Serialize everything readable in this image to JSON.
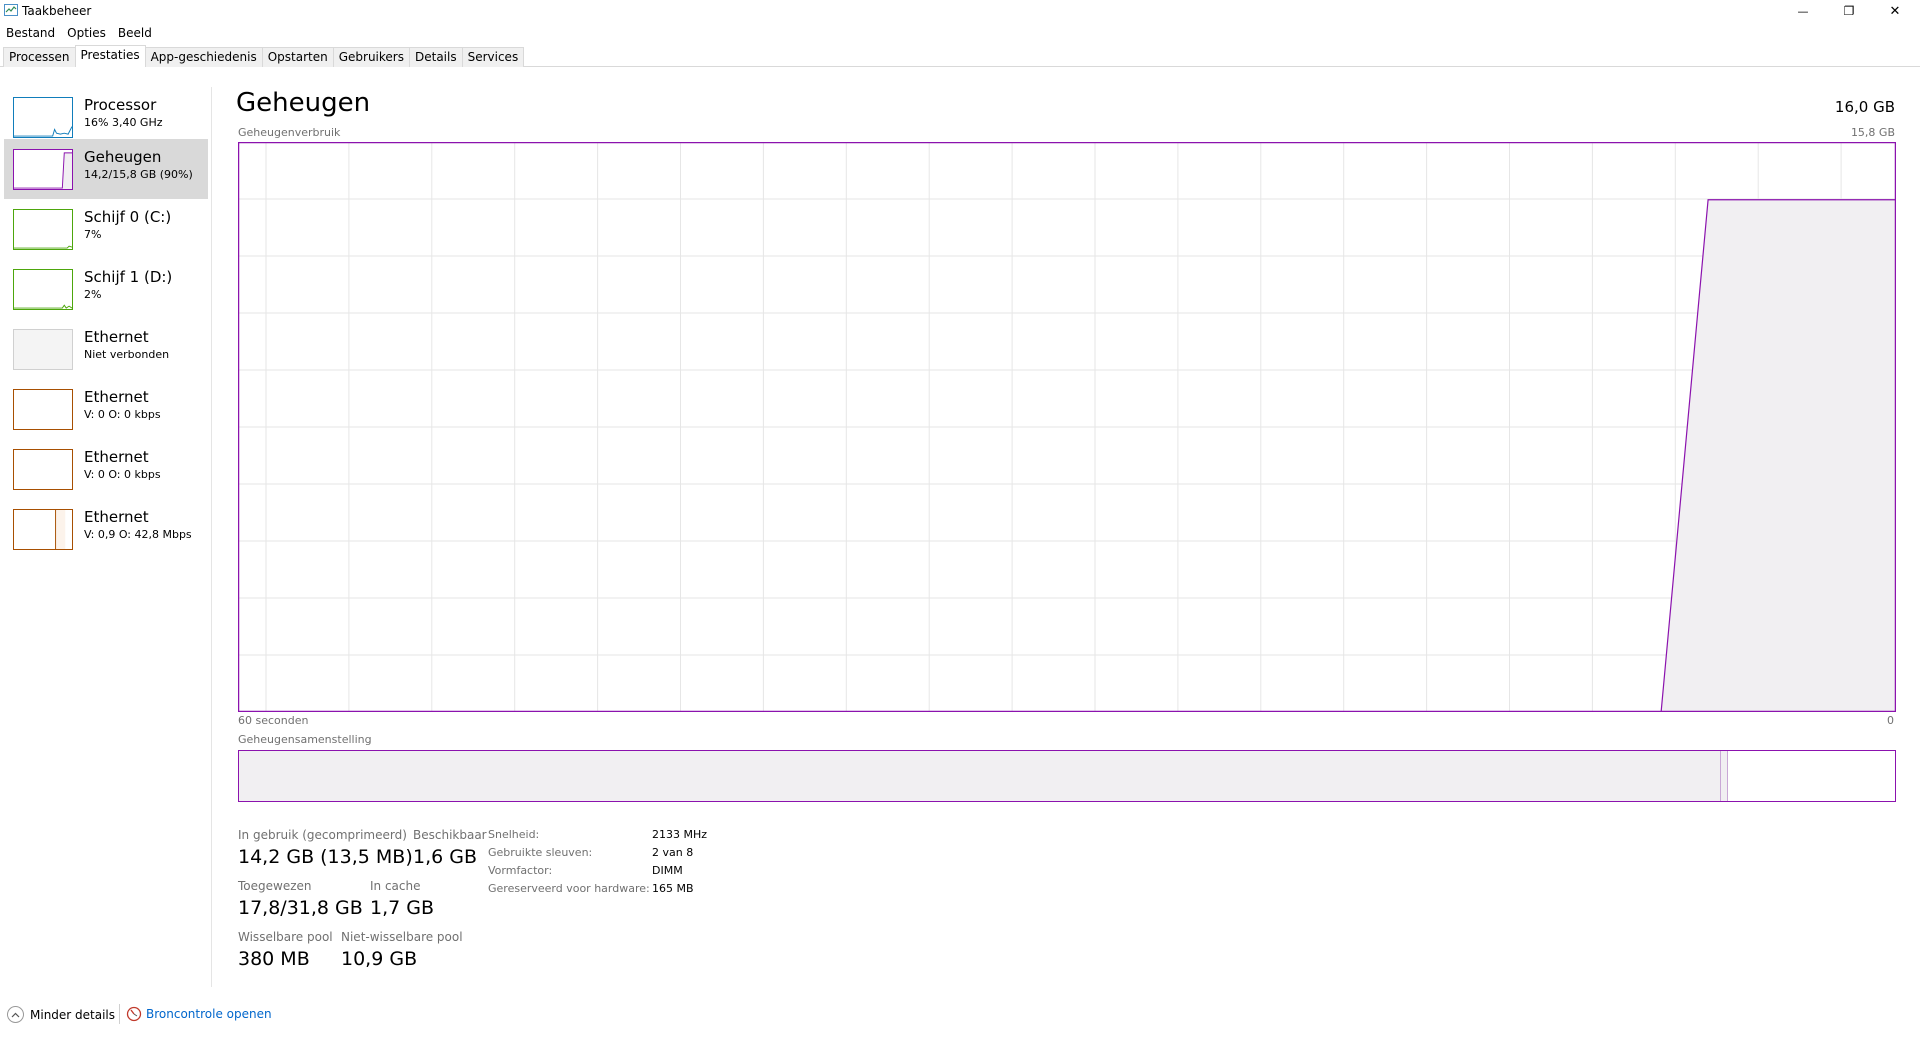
{
  "window": {
    "title": "Taakbeheer",
    "minimize_glyph": "—",
    "restore_glyph": "❐",
    "close_glyph": "✕"
  },
  "menu": [
    "Bestand",
    "Opties",
    "Beeld"
  ],
  "tabs": [
    {
      "label": "Processen",
      "active": false
    },
    {
      "label": "Prestaties",
      "active": true
    },
    {
      "label": "App-geschiedenis",
      "active": false
    },
    {
      "label": "Opstarten",
      "active": false
    },
    {
      "label": "Gebruikers",
      "active": false
    },
    {
      "label": "Details",
      "active": false
    },
    {
      "label": "Services",
      "active": false
    }
  ],
  "sidebar": {
    "items": [
      {
        "name": "Processor",
        "sub": "16% 3,40 GHz",
        "color": "#117dbb",
        "icon": "processor-graph"
      },
      {
        "name": "Geheugen",
        "sub": "14,2/15,8 GB (90%)",
        "color": "#8b12ae",
        "icon": "memory-graph"
      },
      {
        "name": "Schijf 0 (C:)",
        "sub": "7%",
        "color": "#4da60c",
        "icon": "disk-graph"
      },
      {
        "name": "Schijf 1 (D:)",
        "sub": "2%",
        "color": "#4da60c",
        "icon": "disk-graph"
      },
      {
        "name": "Ethernet",
        "sub": "Niet verbonden",
        "color": "#c8c8c8",
        "icon": "ethernet-graph"
      },
      {
        "name": "Ethernet",
        "sub": "V: 0 O: 0 kbps",
        "color": "#a74f01",
        "icon": "ethernet-graph"
      },
      {
        "name": "Ethernet",
        "sub": "V: 0 O: 0 kbps",
        "color": "#a74f01",
        "icon": "ethernet-graph"
      },
      {
        "name": "Ethernet",
        "sub": "V: 0,9 O: 42,8 Mbps",
        "color": "#a74f01",
        "icon": "ethernet-graph"
      }
    ]
  },
  "main": {
    "title": "Geheugen",
    "total": "16,0 GB",
    "usage_label": "Geheugenverbruik",
    "usage_max": "15,8 GB",
    "axis_left": "60 seconden",
    "axis_right": "0",
    "composition_label": "Geheugensamenstelling",
    "accent_color": "#8b12ae"
  },
  "chart_data": {
    "type": "area",
    "x": [
      60,
      8.5,
      6.8,
      0
    ],
    "values": [
      0,
      0,
      14.2,
      14.2
    ],
    "ylim": [
      0,
      15.8
    ],
    "xlim": [
      60,
      0
    ],
    "grid": true
  },
  "composition": {
    "in_use_fraction": 0.895,
    "modified_fraction": 0.004
  },
  "stats": {
    "in_use_label": "In gebruik (gecomprimeerd)",
    "in_use_value": "14,2 GB (13,5 MB)",
    "available_label": "Beschikbaar",
    "available_value": "1,6 GB",
    "committed_label": "Toegewezen",
    "committed_value": "17,8/31,8 GB",
    "cached_label": "In cache",
    "cached_value": "1,7 GB",
    "paged_label": "Wisselbare pool",
    "paged_value": "380 MB",
    "nonpaged_label": "Niet-wisselbare pool",
    "nonpaged_value": "10,9 GB"
  },
  "details": [
    {
      "label": "Snelheid:",
      "value": "2133 MHz"
    },
    {
      "label": "Gebruikte sleuven:",
      "value": "2 van 8"
    },
    {
      "label": "Vormfactor:",
      "value": "DIMM"
    },
    {
      "label": "Gereserveerd voor hardware:",
      "value": "165 MB"
    }
  ],
  "footer": {
    "less_details": "Minder details",
    "resource_monitor": "Broncontrole openen"
  }
}
